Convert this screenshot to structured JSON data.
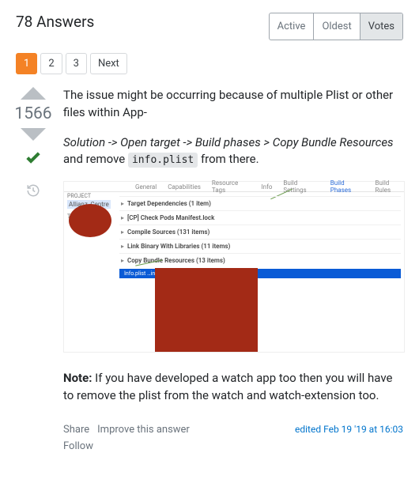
{
  "header": {
    "title": "78 Answers"
  },
  "sort": {
    "active": "Active",
    "oldest": "Oldest",
    "votes": "Votes"
  },
  "pager": {
    "p1": "1",
    "p2": "2",
    "p3": "3",
    "next": "Next"
  },
  "vote": {
    "count": "1566"
  },
  "body": {
    "p1": "The issue might be occurring because of multiple Plist or other files within App-",
    "solution_label": "Solution -> Open target -> Build phases > Copy Bundle Resources",
    "solution_tail1": " and remove ",
    "solution_code": "info.plist",
    "solution_tail2": " from there.",
    "note_label": "Note:",
    "note_text": " If you have developed a watch app too then you will have to remove the plist from the watch and watch-extension too."
  },
  "screenshot": {
    "tabs": {
      "general": "General",
      "capabilities": "Capabilities",
      "resource": "Resource Tags",
      "info": "Info",
      "build_settings": "Build Settings",
      "build_phases": "Build Phases",
      "build_rules": "Build Rules"
    },
    "project_label": "PROJECT",
    "project_name": "Allianz_Centre",
    "targets_label": "TARGETS",
    "rows": {
      "r1": "Target Dependencies (1 item)",
      "r2": "[CP] Check Pods Manifest.lock",
      "r3": "Compile Sources (131 items)",
      "r4": "Link Binary With Libraries (11 items)",
      "r5": "Copy Bundle Resources (13 items)"
    },
    "selected": "Info.plist …in Allianz_Centre"
  },
  "actions": {
    "share": "Share",
    "improve": "Improve this answer",
    "follow": "Follow",
    "edited": "edited Feb 19 '19 at 16:03"
  }
}
